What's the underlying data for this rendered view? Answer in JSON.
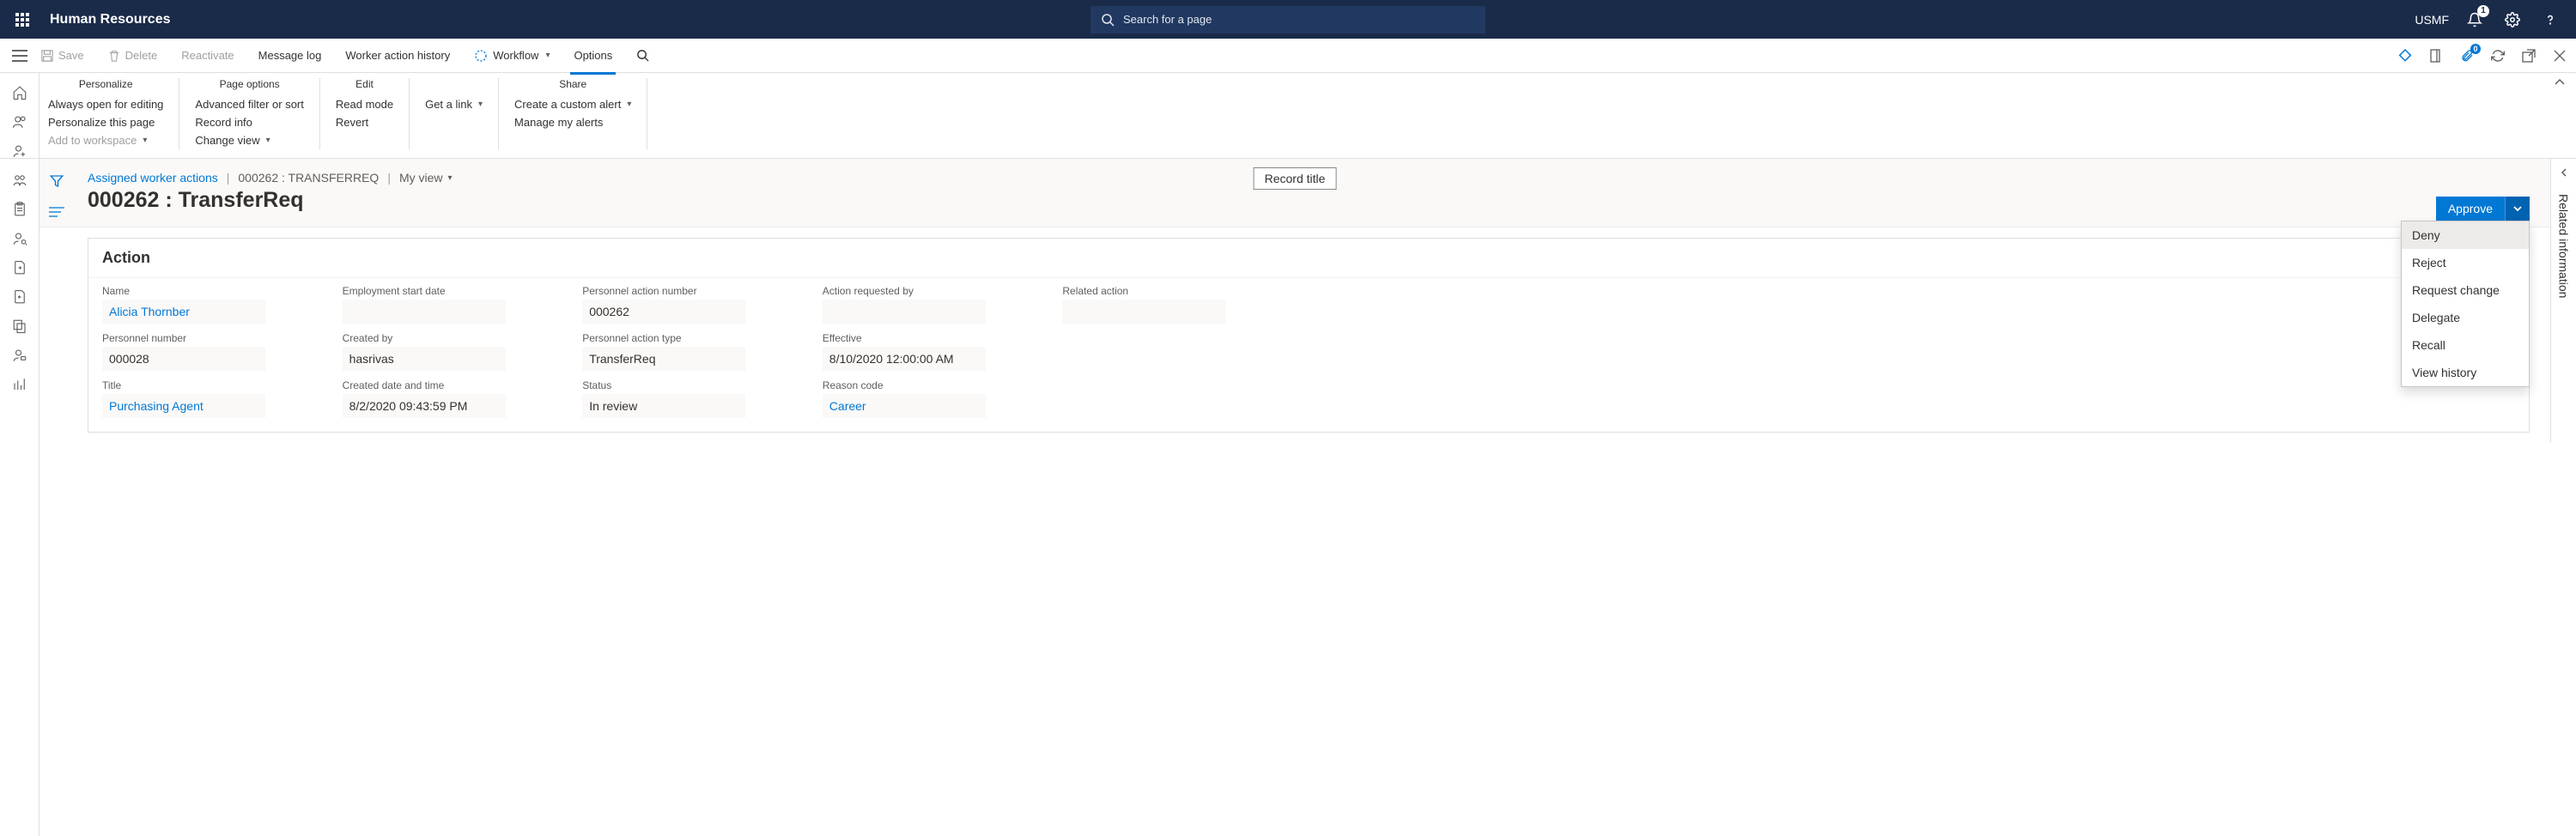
{
  "header": {
    "app_title": "Human Resources",
    "search_placeholder": "Search for a page",
    "company": "USMF",
    "bell_badge": "1"
  },
  "cmdbar": {
    "save": "Save",
    "delete": "Delete",
    "reactivate": "Reactivate",
    "message_log": "Message log",
    "worker_action_history": "Worker action history",
    "workflow": "Workflow",
    "options": "Options",
    "attach_badge": "0"
  },
  "ribbon": {
    "personalize": {
      "title": "Personalize",
      "always_open": "Always open for editing",
      "personalize_page": "Personalize this page",
      "add_workspace": "Add to workspace"
    },
    "page_options": {
      "title": "Page options",
      "adv_filter": "Advanced filter or sort",
      "record_info": "Record info",
      "change_view": "Change view"
    },
    "edit": {
      "title": "Edit",
      "read_mode": "Read mode",
      "revert": "Revert"
    },
    "get_link": {
      "label": "Get a link"
    },
    "share": {
      "title": "Share",
      "custom_alert": "Create a custom alert",
      "manage_alerts": "Manage my alerts"
    }
  },
  "breadcrumb": {
    "assigned": "Assigned worker actions",
    "record": "000262 : TRANSFERREQ",
    "view": "My view"
  },
  "page_title": "000262 : TransferReq",
  "record_chip": "Record title",
  "approve": {
    "label": "Approve",
    "menu": [
      "Deny",
      "Reject",
      "Request change",
      "Delegate",
      "Recall",
      "View history"
    ]
  },
  "card": {
    "title": "Action",
    "timestamp": "8/10/2020 12:0",
    "fields": {
      "name_label": "Name",
      "name": "Alicia Thornber",
      "pnum_label": "Personnel number",
      "pnum": "000028",
      "title_label": "Title",
      "title": "Purchasing Agent",
      "emp_start_label": "Employment start date",
      "emp_start": "",
      "created_by_label": "Created by",
      "created_by": "hasrivas",
      "created_dt_label": "Created date and time",
      "created_dt": "8/2/2020 09:43:59 PM",
      "pan_label": "Personnel action number",
      "pan": "000262",
      "pat_label": "Personnel action type",
      "pat": "TransferReq",
      "status_label": "Status",
      "status": "In review",
      "arb_label": "Action requested by",
      "arb": "",
      "eff_label": "Effective",
      "eff": "8/10/2020 12:00:00 AM",
      "reason_label": "Reason code",
      "reason": "Career",
      "related_label": "Related action",
      "related": ""
    }
  },
  "right_panel": {
    "label": "Related information"
  }
}
